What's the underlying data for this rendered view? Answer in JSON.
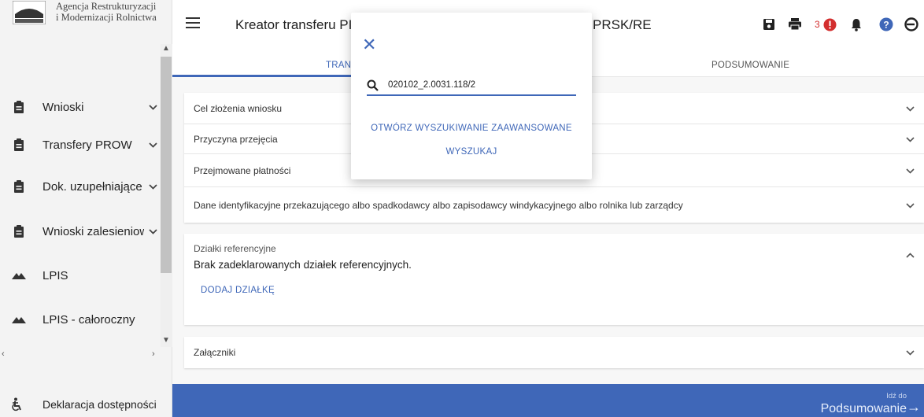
{
  "colors": {
    "primary": "#3f67b8",
    "danger": "#d32f2f"
  },
  "logo": {
    "line1": "Agencja Restrukturyzacji",
    "line2": "i Modernizacji Rolnictwa"
  },
  "sidebar": {
    "items": [
      {
        "label": "Wnioski",
        "icon": "clipboard-icon",
        "expandable": true
      },
      {
        "label": "Transfery PROW",
        "icon": "clipboard-icon",
        "expandable": true
      },
      {
        "label": "Dok. uzupełniające",
        "icon": "clipboard-icon",
        "expandable": true
      },
      {
        "label": "Wnioski zalesieniowe",
        "icon": "clipboard-icon",
        "expandable": true
      },
      {
        "label": "LPIS",
        "icon": "terrain-icon",
        "expandable": false
      },
      {
        "label": "LPIS - całoroczny",
        "icon": "terrain-icon",
        "expandable": false
      }
    ],
    "bottom_item": {
      "label": "Deklaracja dostępności",
      "icon": "accessibility-icon"
    }
  },
  "topbar": {
    "title": "Kreator transferu PI",
    "title_suffix": "PRSK/RE",
    "notification_count": "3"
  },
  "tabs": [
    {
      "label": "TRAN",
      "active": true
    },
    {
      "label": "PODSUMOWANIE",
      "active": false
    }
  ],
  "sections": {
    "rows": [
      "Cel złożenia wniosku",
      "Przyczyna przejęcia",
      "Przejmowane płatności",
      "Dane identyfikacyjne przekazującego albo spadkodawcy albo zapisodawcy windykacyjnego albo rolnika lub zarządcy"
    ],
    "plots_title": "Działki referencyjne",
    "plots_message": "Brak zadeklarowanych działek referencyjnych.",
    "add_plot": "DODAJ DZIAŁKĘ",
    "attachments": "Załączniki"
  },
  "bottombar": {
    "next_small": "Idź do",
    "next_big": "Podsumowanie"
  },
  "modal": {
    "search_value": "020102_2.0031.118/2",
    "advanced_search": "OTWÓRZ WYSZUKIWANIE ZAAWANSOWANE",
    "search_button": "WYSZUKAJ"
  }
}
